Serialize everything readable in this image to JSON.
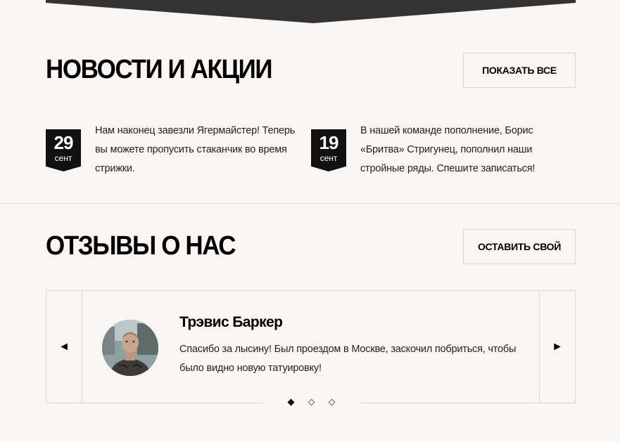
{
  "news": {
    "title": "НОВОСТИ И АКЦИИ",
    "show_all_label": "ПОКАЗАТЬ ВСЕ",
    "items": [
      {
        "day": "29",
        "month": "сент",
        "text": "Нам наконец завезли Ягермайстер! Теперь вы можете пропусить стаканчик во время стрижки."
      },
      {
        "day": "19",
        "month": "сент",
        "text": "В нашей команде пополнение, Борис «Бритва» Стригунец, пополнил наши стройные ряды. Спешите записаться!"
      }
    ]
  },
  "reviews": {
    "title": "ОТЗЫВЫ О НАС",
    "leave_label": "ОСТАВИТЬ СВОЙ",
    "prev_arrow": "◄",
    "next_arrow": "►",
    "current": {
      "name": "Трэвис Баркер",
      "text": "Спасибо за лысину! Был проездом в Москве, заскочил побриться, чтобы было видно новую татуировку!"
    },
    "pagination": {
      "total": 3,
      "active": 1
    }
  },
  "colors": {
    "background": "#f8f5f2",
    "dark": "#111111",
    "border": "#dcd8d4",
    "banner": "#333333"
  }
}
